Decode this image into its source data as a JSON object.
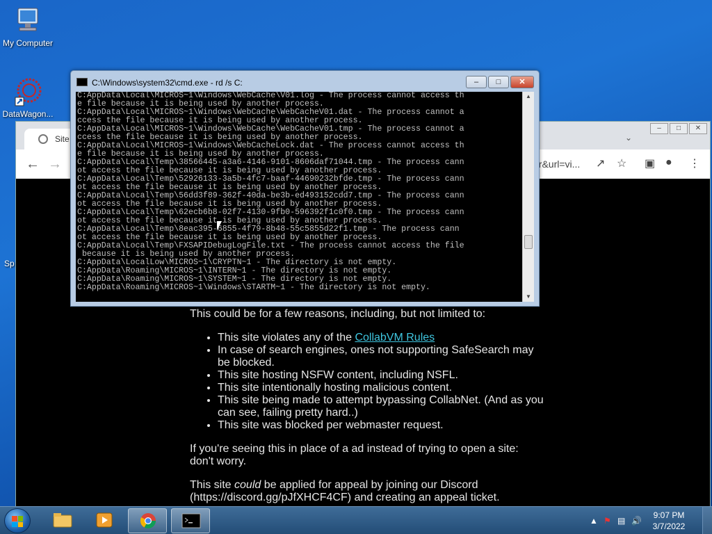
{
  "desktop": {
    "icons": [
      {
        "label": "My Computer"
      },
      {
        "label": "DataWagon..."
      }
    ],
    "partial_labels": [
      "Sp"
    ]
  },
  "chrome": {
    "tab_label": "Site Bl",
    "omnibox_tail": "er&url=vi...",
    "content": {
      "reasons_intro": "This could be for a few reasons, including, but not limited to:",
      "reasons": [
        {
          "prefix": "This site violates any of the ",
          "link": "CollabVM Rules"
        },
        {
          "text": "In case of search engines, ones not supporting SafeSearch may be blocked."
        },
        {
          "text": "This site hosting NSFW content, including NSFL."
        },
        {
          "text": "This site intentionally hosting malicious content."
        },
        {
          "text": "This site being made to attempt bypassing CollabNet. (And as you can see, failing pretty hard..)"
        },
        {
          "text": "This site was blocked per webmaster request."
        }
      ],
      "ad_note": "If you're seeing this in place of a ad instead of trying to open a site: don't worry.",
      "appeal_pre": "This site ",
      "appeal_em": "could",
      "appeal_post": " be applied for appeal by joining our Discord (https://discord.gg/pJfXHCF4CF) and creating an appeal ticket."
    }
  },
  "cmd": {
    "title": "C:\\Windows\\system32\\cmd.exe - rd  /s C:",
    "lines": [
      "C:AppData\\Local\\MICROS~1\\Windows\\WebCache\\V01.log - The process cannot access th",
      "e file because it is being used by another process.",
      "C:AppData\\Local\\MICROS~1\\Windows\\WebCache\\WebCacheV01.dat - The process cannot a",
      "ccess the file because it is being used by another process.",
      "C:AppData\\Local\\MICROS~1\\Windows\\WebCache\\WebCacheV01.tmp - The process cannot a",
      "ccess the file because it is being used by another process.",
      "C:AppData\\Local\\MICROS~1\\Windows\\WebCacheLock.dat - The process cannot access th",
      "e file because it is being used by another process.",
      "C:AppData\\Local\\Temp\\38566445-a3a6-4146-9101-8606daf71044.tmp - The process cann",
      "ot access the file because it is being used by another process.",
      "C:AppData\\Local\\Temp\\52926133-3a5b-4fc7-baaf-44690232bfde.tmp - The process cann",
      "ot access the file because it is being used by another process.",
      "C:AppData\\Local\\Temp\\56dd3f89-362f-40da-be3b-ed493152cdd7.tmp - The process cann",
      "ot access the file because it is being used by another process.",
      "C:AppData\\Local\\Temp\\62ecb6b8-02f7-4130-9fb0-596392f1c0f0.tmp - The process cann",
      "ot access the file because it is being used by another process.",
      "C:AppData\\Local\\Temp\\8eac395-6855-4f79-8b48-55c5855d22f1.tmp - The process cann",
      "ot access the file because it is being used by another process.",
      "C:AppData\\Local\\Temp\\FXSAPIDebugLogFile.txt - The process cannot access the file",
      " because it is being used by another process.",
      "C:AppData\\LocalLow\\MICROS~1\\CRYPTN~1 - The directory is not empty.",
      "C:AppData\\Roaming\\MICROS~1\\INTERN~1 - The directory is not empty.",
      "C:AppData\\Roaming\\MICROS~1\\SYSTEM~1 - The directory is not empty.",
      "C:AppData\\Roaming\\MICROS~1\\Windows\\STARTM~1 - The directory is not empty."
    ]
  },
  "taskbar": {
    "time": "9:07 PM",
    "date": "3/7/2022"
  }
}
